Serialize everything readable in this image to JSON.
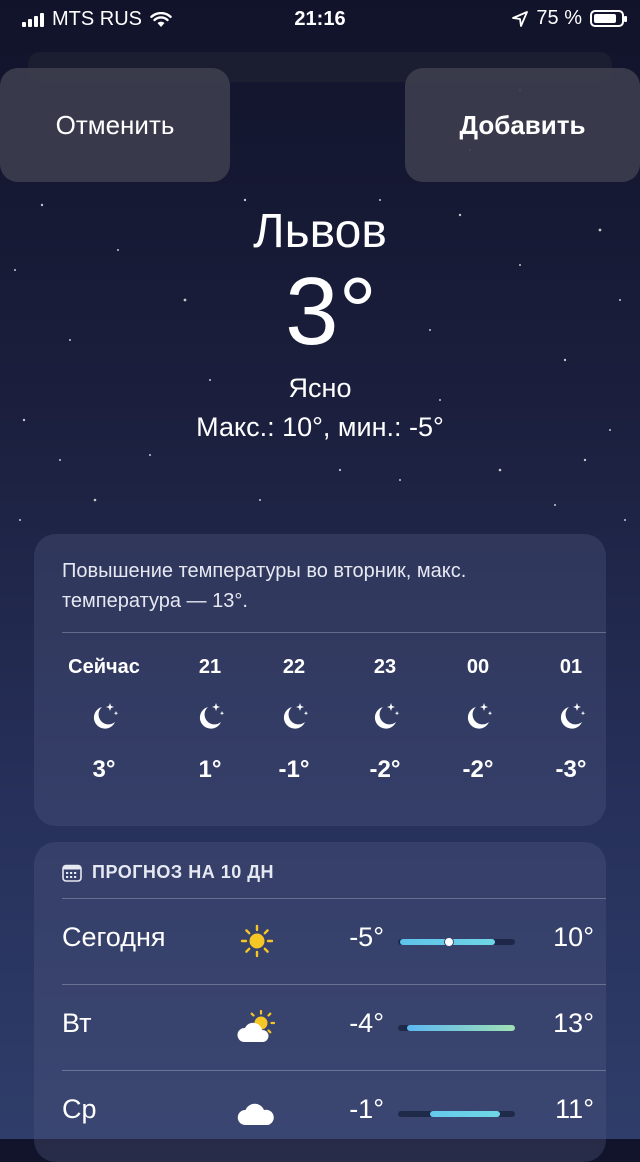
{
  "status_bar": {
    "carrier": "MTS RUS",
    "time": "21:16",
    "battery": "75 %"
  },
  "buttons": {
    "cancel": "Отменить",
    "add": "Добавить"
  },
  "current": {
    "city": "Львов",
    "temperature": "3°",
    "condition": "Ясно",
    "hi_lo": "Макс.: 10°, мин.: -5°"
  },
  "hourly": {
    "summary": "Повышение температуры во вторник, макс. температура — 13°.",
    "items": [
      {
        "label": "Сейчас",
        "icon": "moon-stars-icon",
        "temp": "3°"
      },
      {
        "label": "21",
        "icon": "moon-stars-icon",
        "temp": "1°"
      },
      {
        "label": "22",
        "icon": "moon-stars-icon",
        "temp": "-1°"
      },
      {
        "label": "23",
        "icon": "moon-stars-icon",
        "temp": "-2°"
      },
      {
        "label": "00",
        "icon": "moon-stars-icon",
        "temp": "-2°"
      },
      {
        "label": "01",
        "icon": "moon-stars-icon",
        "temp": "-3°"
      }
    ]
  },
  "daily": {
    "title": "ПРОГНОЗ НА 10 ДН",
    "days": [
      {
        "name": "Сегодня",
        "icon": "sun-icon",
        "min": "-5°",
        "max": "10°",
        "range": [
          0.02,
          0.83
        ],
        "current": 0.44,
        "color_from": "#5ec3ea",
        "color_to": "#6fd6e6"
      },
      {
        "name": "Вт",
        "icon": "partly-cloudy-icon",
        "min": "-4°",
        "max": "13°",
        "range": [
          0.08,
          1.0
        ],
        "color_from": "#5cb8f2",
        "color_to": "#9fe0b4"
      },
      {
        "name": "Ср",
        "icon": "cloud-icon",
        "min": "-1°",
        "max": "11°",
        "range": [
          0.27,
          0.87
        ],
        "color_from": "#64c9ec",
        "color_to": "#6fd7e4"
      }
    ]
  },
  "colors": {
    "accent_sun": "#f5c624",
    "moon": "#ffffff"
  }
}
